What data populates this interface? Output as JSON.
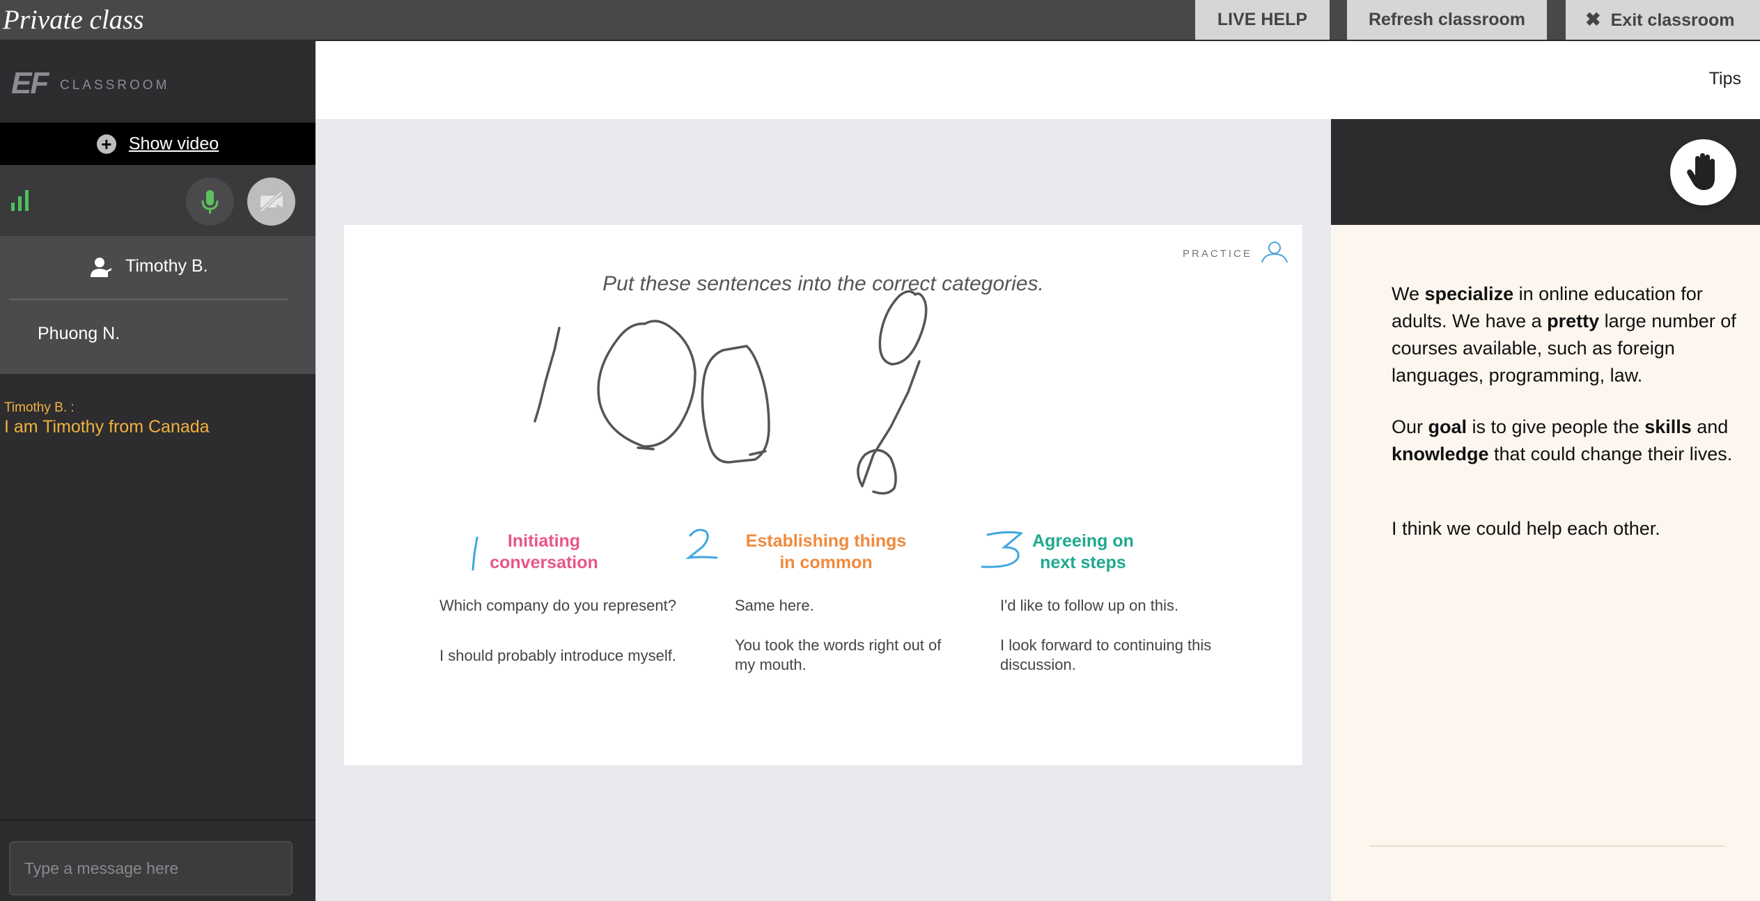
{
  "window": {
    "title": "Private class"
  },
  "topbar": {
    "live_help": "LIVE HELP",
    "refresh": "Refresh classroom",
    "exit": "Exit classroom"
  },
  "sidebar": {
    "logo_mark": "EF",
    "logo_text": "CLASSROOM",
    "show_video": "Show video",
    "participants": [
      {
        "name": "Timothy B.",
        "role": "teacher"
      },
      {
        "name": "Phuong N."
      }
    ],
    "chat": {
      "messages": [
        {
          "author": "Timothy B. :",
          "text": "I am Timothy from Canada"
        }
      ],
      "input_placeholder": "Type a message here"
    }
  },
  "header": {
    "tips": "Tips"
  },
  "slide": {
    "tag": "PRACTICE",
    "instruction": "Put these sentences into the correct categories.",
    "categories": [
      {
        "title_line1": "Initiating",
        "title_line2": "conversation",
        "color": "#e8558a",
        "sentences": [
          "Which company do you represent?",
          "I should probably introduce myself."
        ]
      },
      {
        "title_line1": "Establishing things",
        "title_line2": "in common",
        "color": "#f08a3c",
        "sentences": [
          "Same here.",
          "You took the words right out of my mouth."
        ]
      },
      {
        "title_line1": "Agreeing on",
        "title_line2": "next steps",
        "color": "#1fa98f",
        "sentences": [
          "I'd like to follow up on this.",
          "I look forward to continuing this discussion."
        ]
      }
    ]
  },
  "notes": {
    "p1": {
      "a": "We ",
      "b1": "specialize",
      "c": " in online education for adults. We have a ",
      "b2": "pretty",
      "d": " large number of courses available, such as foreign languages, programming, law."
    },
    "p2": {
      "a": "Our ",
      "b1": "goal",
      "c": " is to give people the ",
      "b2": "skills",
      "d": " and ",
      "b3": "knowledge",
      "e": " that could change their lives."
    },
    "p3": "I think we could help each other."
  },
  "icons": {
    "signal": "signal-bars-icon",
    "mic": "microphone-icon",
    "camera_off": "camera-off-icon",
    "raise_hand": "raise-hand-icon",
    "user": "user-icon",
    "close": "close-icon",
    "plus": "plus-icon"
  },
  "colors": {
    "chat_author": "#f3b13c",
    "signal_green": "#4cc25a",
    "mic_green": "#5cc15c",
    "annotation_blue": "#3ea7e0"
  }
}
